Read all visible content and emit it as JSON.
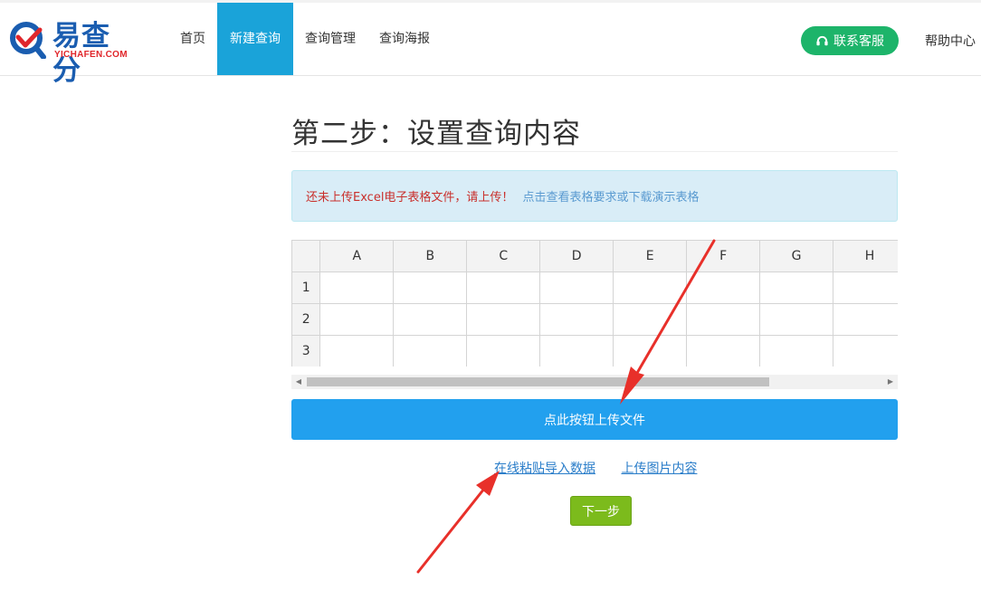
{
  "brand": {
    "name_cn": "易查分",
    "name_en": "YICHAFEN.COM"
  },
  "nav": [
    "首页",
    "新建查询",
    "查询管理",
    "查询海报"
  ],
  "nav_active": "新建查询",
  "header": {
    "contact_label": "联系客服",
    "help_label": "帮助中心"
  },
  "page": {
    "title": "第二步：设置查询内容"
  },
  "alert": {
    "warning": "还未上传Excel电子表格文件，请上传！",
    "link": "点击查看表格要求或下载演示表格"
  },
  "sheet": {
    "columns": [
      "A",
      "B",
      "C",
      "D",
      "E",
      "F",
      "G",
      "H"
    ],
    "rows": [
      "1",
      "2",
      "3"
    ]
  },
  "actions": {
    "upload": "点此按钮上传文件",
    "paste_import": "在线粘贴导入数据",
    "upload_image": "上传图片内容",
    "next": "下一步"
  },
  "colors": {
    "nav_active": "#1aa3d9",
    "contact": "#1db46a",
    "upload": "#22a0ee",
    "next": "#7cbb1c",
    "annotation_arrow": "#e8302a"
  }
}
